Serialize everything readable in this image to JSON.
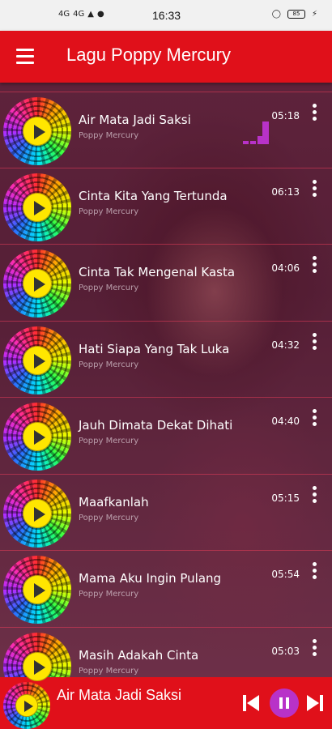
{
  "status_bar": {
    "signal_1": "4G",
    "signal_2": "4G",
    "time": "16:33",
    "battery": "85"
  },
  "app_bar": {
    "title": "Lagu Poppy Mercury",
    "menu_icon": "hamburger-menu-icon"
  },
  "songs": [
    {
      "title": "Air Mata Jadi Saksi",
      "artist": "Poppy Mercury",
      "duration": "05:18",
      "playing": true
    },
    {
      "title": "Cinta Kita Yang Tertunda",
      "artist": "Poppy Mercury",
      "duration": "06:13",
      "playing": false
    },
    {
      "title": "Cinta Tak Mengenal Kasta",
      "artist": "Poppy Mercury",
      "duration": "04:06",
      "playing": false
    },
    {
      "title": "Hati Siapa Yang Tak Luka",
      "artist": "Poppy Mercury",
      "duration": "04:32",
      "playing": false
    },
    {
      "title": "Jauh Dimata Dekat Dihati",
      "artist": "Poppy Mercury",
      "duration": "04:40",
      "playing": false
    },
    {
      "title": "Maafkanlah",
      "artist": "Poppy Mercury",
      "duration": "05:15",
      "playing": false
    },
    {
      "title": "Mama Aku Ingin Pulang",
      "artist": "Poppy Mercury",
      "duration": "05:54",
      "playing": false
    },
    {
      "title": "Masih Adakah Cinta",
      "artist": "Poppy Mercury",
      "duration": "05:03",
      "playing": false
    }
  ],
  "player": {
    "now_playing": "Air Mata Jadi Saksi",
    "state": "playing"
  },
  "colors": {
    "accent": "#e0101a",
    "play_button": "#ffe600",
    "pause_button": "#b832c8",
    "equalizer": "#b832c8"
  }
}
